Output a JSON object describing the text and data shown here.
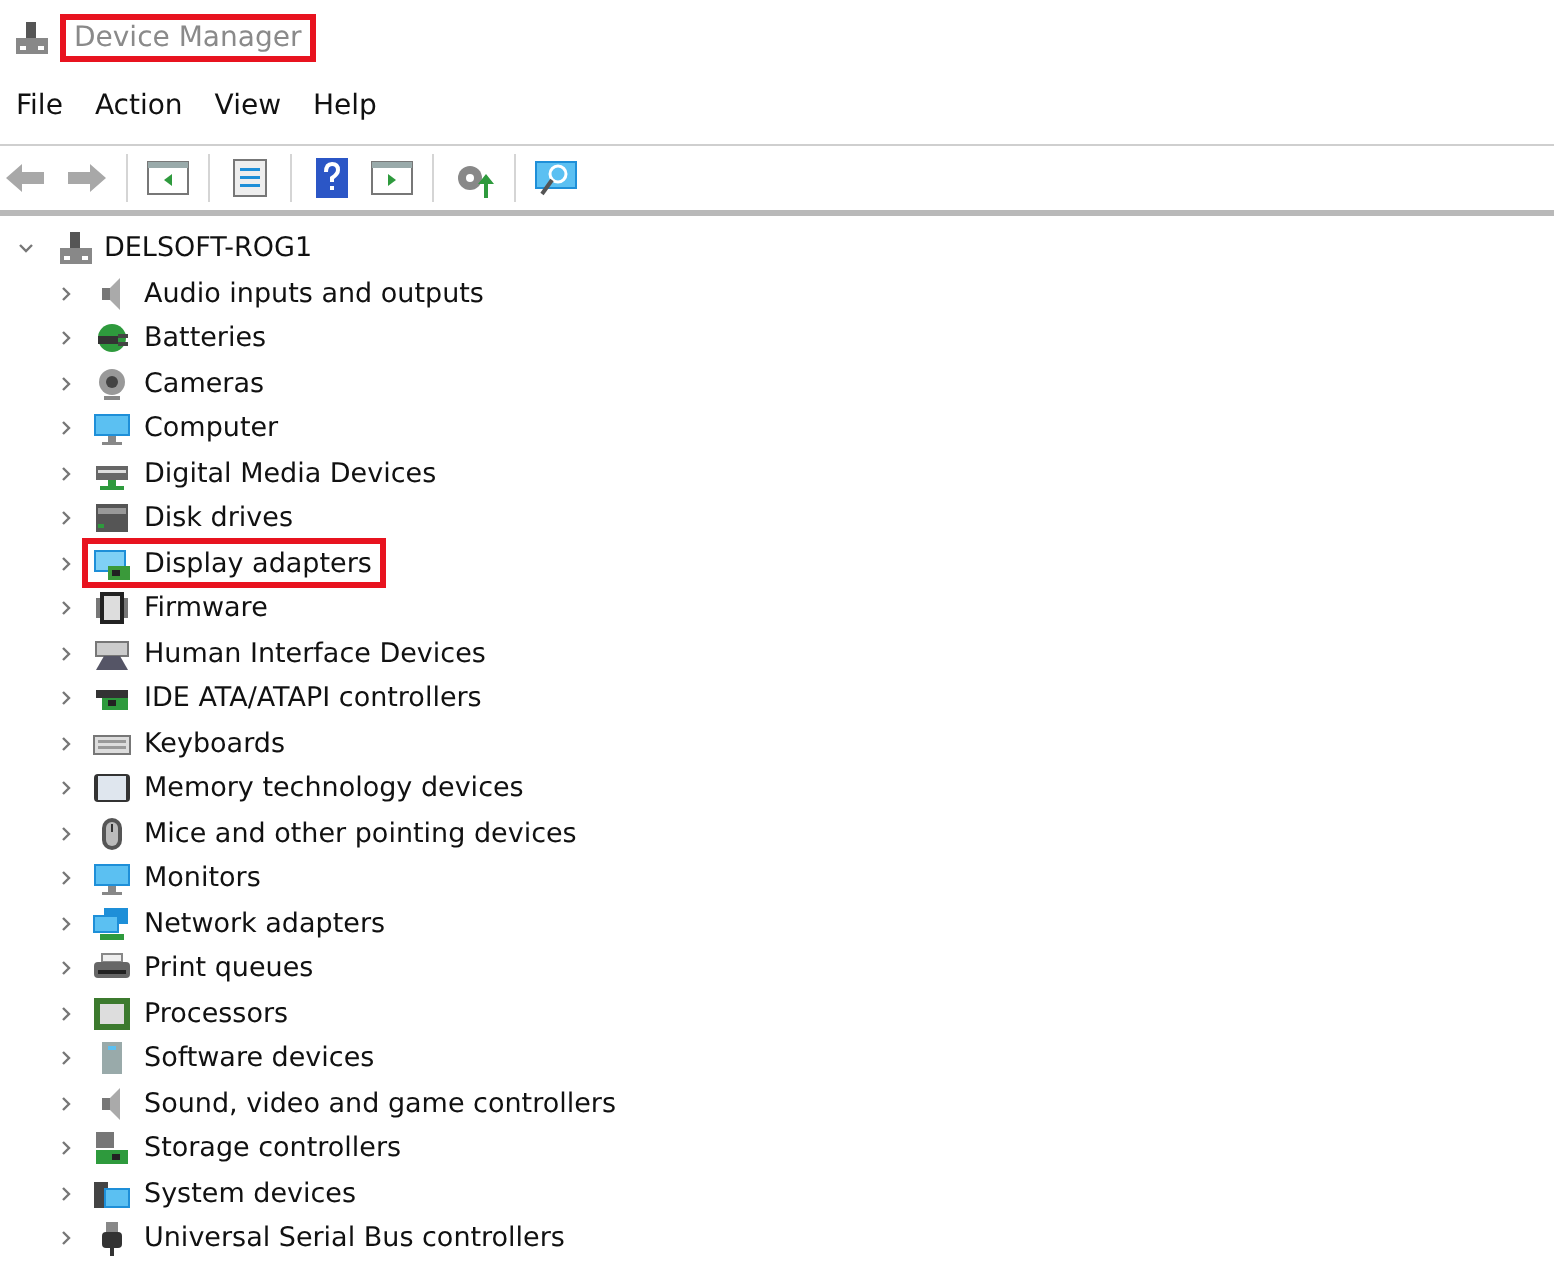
{
  "window": {
    "title": "Device Manager",
    "title_highlighted": true
  },
  "menu": [
    "File",
    "Action",
    "View",
    "Help"
  ],
  "toolbar": [
    {
      "kind": "back",
      "disabled": true
    },
    {
      "kind": "forward",
      "disabled": true
    },
    {
      "kind": "separator"
    },
    {
      "kind": "console-tree",
      "disabled": false
    },
    {
      "kind": "separator"
    },
    {
      "kind": "properties",
      "disabled": false
    },
    {
      "kind": "separator"
    },
    {
      "kind": "help",
      "disabled": false
    },
    {
      "kind": "action-pane",
      "disabled": false
    },
    {
      "kind": "separator"
    },
    {
      "kind": "update-driver",
      "disabled": false
    },
    {
      "kind": "separator"
    },
    {
      "kind": "scan",
      "disabled": false
    }
  ],
  "tree": {
    "label": "DELSOFT-ROG1",
    "kind": "computer-node",
    "expanded": true,
    "children": [
      {
        "label": "Audio inputs and outputs",
        "kind": "speaker",
        "expanded": false,
        "highlighted": false
      },
      {
        "label": "Batteries",
        "kind": "battery",
        "expanded": false,
        "highlighted": false
      },
      {
        "label": "Cameras",
        "kind": "camera",
        "expanded": false,
        "highlighted": false
      },
      {
        "label": "Computer",
        "kind": "monitor",
        "expanded": false,
        "highlighted": false
      },
      {
        "label": "Digital Media Devices",
        "kind": "media",
        "expanded": false,
        "highlighted": false
      },
      {
        "label": "Disk drives",
        "kind": "disk",
        "expanded": false,
        "highlighted": false
      },
      {
        "label": "Display adapters",
        "kind": "display",
        "expanded": false,
        "highlighted": true
      },
      {
        "label": "Firmware",
        "kind": "chip",
        "expanded": false,
        "highlighted": false
      },
      {
        "label": "Human Interface Devices",
        "kind": "hid",
        "expanded": false,
        "highlighted": false
      },
      {
        "label": "IDE ATA/ATAPI controllers",
        "kind": "card",
        "expanded": false,
        "highlighted": false
      },
      {
        "label": "Keyboards",
        "kind": "keyboard",
        "expanded": false,
        "highlighted": false
      },
      {
        "label": "Memory technology devices",
        "kind": "memory",
        "expanded": false,
        "highlighted": false
      },
      {
        "label": "Mice and other pointing devices",
        "kind": "mouse",
        "expanded": false,
        "highlighted": false
      },
      {
        "label": "Monitors",
        "kind": "monitor",
        "expanded": false,
        "highlighted": false
      },
      {
        "label": "Network adapters",
        "kind": "network",
        "expanded": false,
        "highlighted": false
      },
      {
        "label": "Print queues",
        "kind": "printer",
        "expanded": false,
        "highlighted": false
      },
      {
        "label": "Processors",
        "kind": "cpu",
        "expanded": false,
        "highlighted": false
      },
      {
        "label": "Software devices",
        "kind": "tower",
        "expanded": false,
        "highlighted": false
      },
      {
        "label": "Sound, video and game controllers",
        "kind": "speaker",
        "expanded": false,
        "highlighted": false
      },
      {
        "label": "Storage controllers",
        "kind": "storage",
        "expanded": false,
        "highlighted": false
      },
      {
        "label": "System devices",
        "kind": "system",
        "expanded": false,
        "highlighted": false
      },
      {
        "label": "Universal Serial Bus controllers",
        "kind": "usb",
        "expanded": false,
        "highlighted": false
      }
    ]
  }
}
